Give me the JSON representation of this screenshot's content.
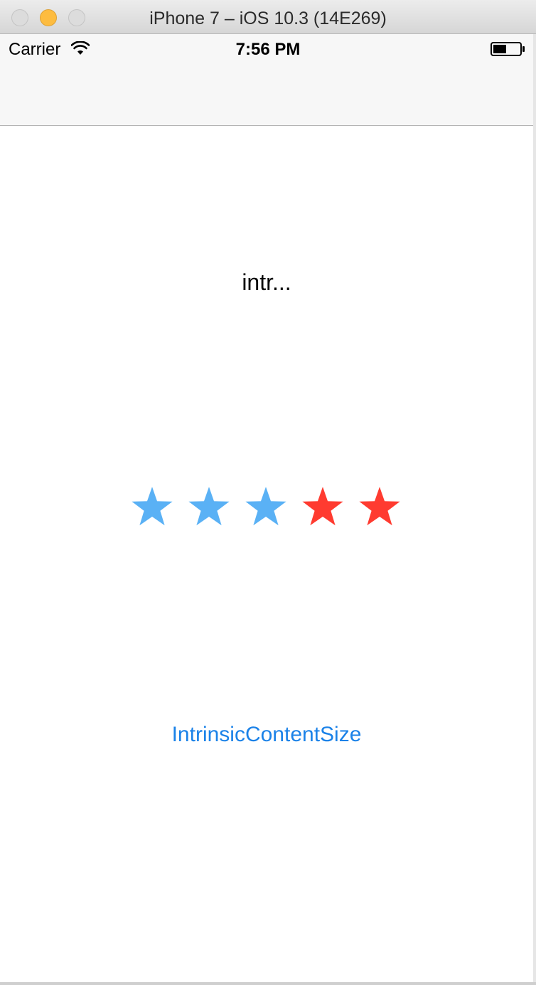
{
  "window": {
    "title": "iPhone 7 – iOS 10.3 (14E269)"
  },
  "status_bar": {
    "carrier": "Carrier",
    "time": "7:56 PM",
    "wifi_icon": "wifi-icon",
    "battery_icon": "battery-icon"
  },
  "content": {
    "label": "intr...",
    "button_label": "IntrinsicContentSize"
  },
  "rating": {
    "total": 5,
    "filled": 3,
    "filled_color": "#5ab1f5",
    "empty_color": "#ff3b30"
  },
  "colors": {
    "tint": "#1b82e8",
    "traffic_minimize": "#fdbc40"
  }
}
